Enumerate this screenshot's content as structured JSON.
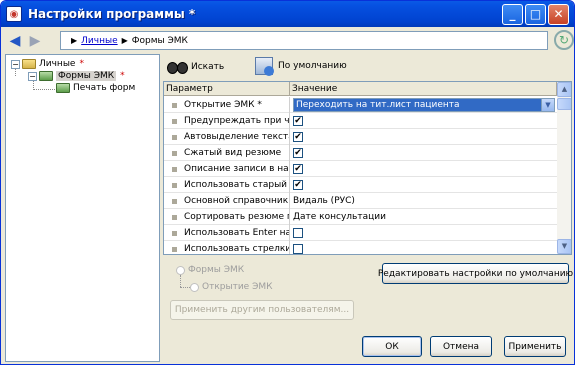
{
  "window": {
    "title": "Настройки программы *"
  },
  "titlebar_buttons": [
    "minimize-button",
    "maximize-button",
    "close-button"
  ],
  "address": {
    "root_link": "Личные",
    "current": "Формы ЭМК"
  },
  "tree": {
    "root": {
      "label": "Личные",
      "marker": "*"
    },
    "child": {
      "label": "Формы ЭМК",
      "marker": "*"
    },
    "leaf": {
      "label": "Печать форм"
    }
  },
  "toolbar": {
    "search_label": "Искать",
    "default_label": "По умолчанию"
  },
  "grid": {
    "columns": [
      "Параметр",
      "Значение"
    ],
    "rows": [
      {
        "name": "Открытие ЭМК *",
        "type": "combo",
        "value": "Переходить на тит.лист пациента"
      },
      {
        "name": "Предупреждать при ча...",
        "type": "check",
        "value": "✔"
      },
      {
        "name": "Автовыделение текста",
        "type": "check",
        "value": "✔"
      },
      {
        "name": "Сжатый вид резюме",
        "type": "check",
        "value": "✔"
      },
      {
        "name": "Описание записи в на...",
        "type": "check",
        "value": "✔"
      },
      {
        "name": "Использовать старый ...",
        "type": "check",
        "value": "✔"
      },
      {
        "name": "Основной справочник ...",
        "type": "text",
        "value": "Видаль (РУС)"
      },
      {
        "name": "Сортировать резюме по",
        "type": "text",
        "value": "Дате консультации"
      },
      {
        "name": "Использовать Enter на...",
        "type": "check",
        "value": ""
      },
      {
        "name": "Использовать стрелки...",
        "type": "check",
        "value": ""
      }
    ]
  },
  "radios": {
    "forms": "Формы ЭМК",
    "opening": "Открытие ЭМК"
  },
  "buttons": {
    "edit_defaults": "Редактировать настройки по умолчанию",
    "apply_others": "Применить другим пользователям...",
    "ok": "ОК",
    "cancel": "Отмена",
    "apply": "Применить"
  }
}
